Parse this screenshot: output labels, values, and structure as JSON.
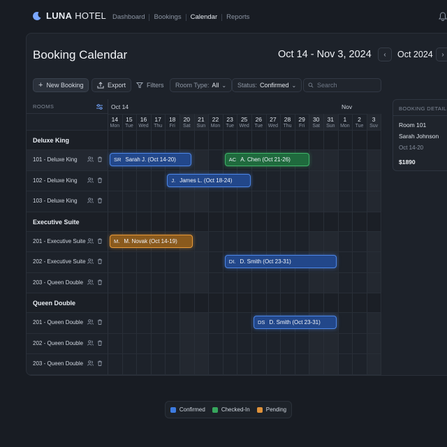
{
  "app": {
    "logo_text_bold": "LUNA",
    "logo_text_rest": " HOTEL"
  },
  "nav": {
    "items": [
      "Dashboard",
      "Bookings",
      "Calendar",
      "Reports"
    ],
    "active": "Calendar"
  },
  "header": {
    "title": "Booking Calendar",
    "range": "Oct 14 - Nov 3, 2024",
    "month": "Oct 2024"
  },
  "toolbar": {
    "new_booking": "New Booking",
    "export": "Export",
    "filters": "Filters",
    "room_type_label": "Room Type:",
    "room_type_value": "All",
    "status_label": "Status:",
    "status_value": "Confirmed",
    "search_placeholder": "Search"
  },
  "grid": {
    "rooms_header": "ROOMS",
    "month_labels": [
      "Oct 14",
      "Nov"
    ],
    "days": [
      {
        "d": "14",
        "w": "Mon"
      },
      {
        "d": "15",
        "w": "Tue"
      },
      {
        "d": "16",
        "w": "Wed"
      },
      {
        "d": "17",
        "w": "Thu"
      },
      {
        "d": "18",
        "w": "Fri"
      },
      {
        "d": "20",
        "w": "Sat"
      },
      {
        "d": "21",
        "w": "Sun"
      },
      {
        "d": "22",
        "w": "Mon"
      },
      {
        "d": "23",
        "w": "Tue"
      },
      {
        "d": "25",
        "w": "Wed"
      },
      {
        "d": "26",
        "w": "Tue"
      },
      {
        "d": "27",
        "w": "Wed"
      },
      {
        "d": "28",
        "w": "Thu"
      },
      {
        "d": "29",
        "w": "Fri"
      },
      {
        "d": "30",
        "w": "Sat"
      },
      {
        "d": "31",
        "w": "Sun"
      },
      {
        "d": "1",
        "w": "Mon"
      },
      {
        "d": "2",
        "w": "Tue"
      },
      {
        "d": "3",
        "w": "Suv"
      }
    ],
    "groups": [
      {
        "name": "Deluxe King",
        "rooms": [
          "101 - Deluxe King",
          "102 - Deluxe King",
          "103 - Deluxe King"
        ]
      },
      {
        "name": "Executive Suite",
        "rooms": [
          "201 - Executive Suite",
          "202 - Executive Suite",
          "203 - Queen Double"
        ]
      },
      {
        "name": "Queen Double",
        "rooms": [
          "201 - Queen Double",
          "202 - Queen Double",
          "203 - Queen Double"
        ]
      }
    ],
    "bookings": [
      {
        "initials": "SR",
        "label": "Sarah J. (Oct 14-20)",
        "status": "confirmed"
      },
      {
        "initials": "AC",
        "label": "A. Chen (Oct 21-26)",
        "status": "checked-in"
      },
      {
        "initials": "J.",
        "label": "James L. (Oct 18-24)",
        "status": "confirmed"
      },
      {
        "initials": "M.",
        "label": "M. Novak (Oct 14-19)",
        "status": "pending"
      },
      {
        "initials": "DI.",
        "label": "D. Smith (Oct 23-31)",
        "status": "confirmed"
      },
      {
        "initials": "DS",
        "label": "D. Smith (Oct 23-31)",
        "status": "confirmed"
      }
    ]
  },
  "details": {
    "header": "BOOKING DETAILS",
    "room": "Room 101",
    "guest": "Sarah Johnson",
    "dates": "Oct 14-20",
    "total": "$1890"
  },
  "legend": {
    "items": [
      "Confirmed",
      "Checked-In",
      "Pending"
    ]
  },
  "colors": {
    "confirmed": "#3d7be0",
    "checked_in": "#37a65d",
    "pending": "#e0923a"
  }
}
